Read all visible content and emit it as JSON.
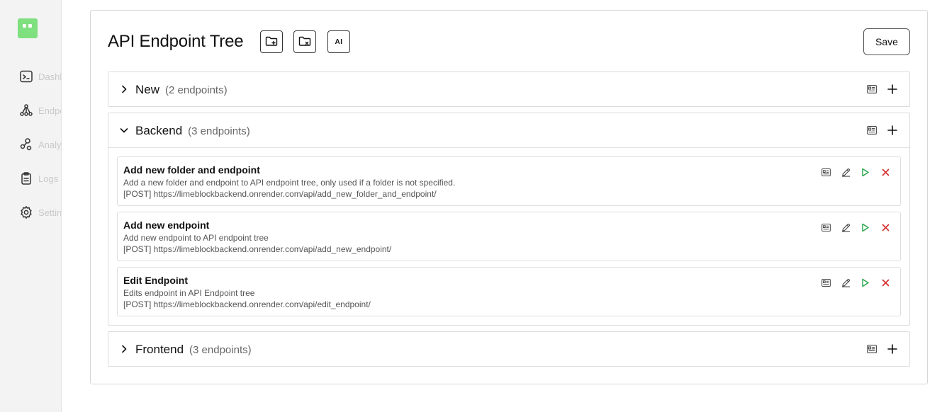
{
  "sidebar": {
    "items": [
      {
        "label": "Dashboard",
        "icon": "terminal-icon"
      },
      {
        "label": "Endpoints",
        "icon": "tree-icon"
      },
      {
        "label": "Analytics",
        "icon": "nodes-icon"
      },
      {
        "label": "Logs",
        "icon": "clipboard-icon"
      },
      {
        "label": "Settings",
        "icon": "gear-icon"
      }
    ]
  },
  "header": {
    "title": "API Endpoint Tree",
    "ai_label": "AI",
    "save_label": "Save"
  },
  "folders": [
    {
      "name": "New",
      "count": "(2 endpoints)",
      "expanded": false
    },
    {
      "name": "Backend",
      "count": "(3 endpoints)",
      "expanded": true,
      "endpoints": [
        {
          "name": "Add new folder and endpoint",
          "description": "Add a new folder and endpoint to API endpoint tree, only used if a folder is not specified.",
          "url": "[POST] https://limeblockbackend.onrender.com/api/add_new_folder_and_endpoint/"
        },
        {
          "name": "Add new endpoint",
          "description": "Add new endpoint to API endpoint tree",
          "url": "[POST] https://limeblockbackend.onrender.com/api/add_new_endpoint/"
        },
        {
          "name": "Edit Endpoint",
          "description": "Edits endpoint in API Endpoint tree",
          "url": "[POST] https://limeblockbackend.onrender.com/api/edit_endpoint/"
        }
      ]
    },
    {
      "name": "Frontend",
      "count": "(3 endpoints)",
      "expanded": false
    }
  ],
  "colors": {
    "brand": "#7ee07e",
    "run": "#22a447",
    "delete": "#d62b2b",
    "icon": "#444444"
  }
}
